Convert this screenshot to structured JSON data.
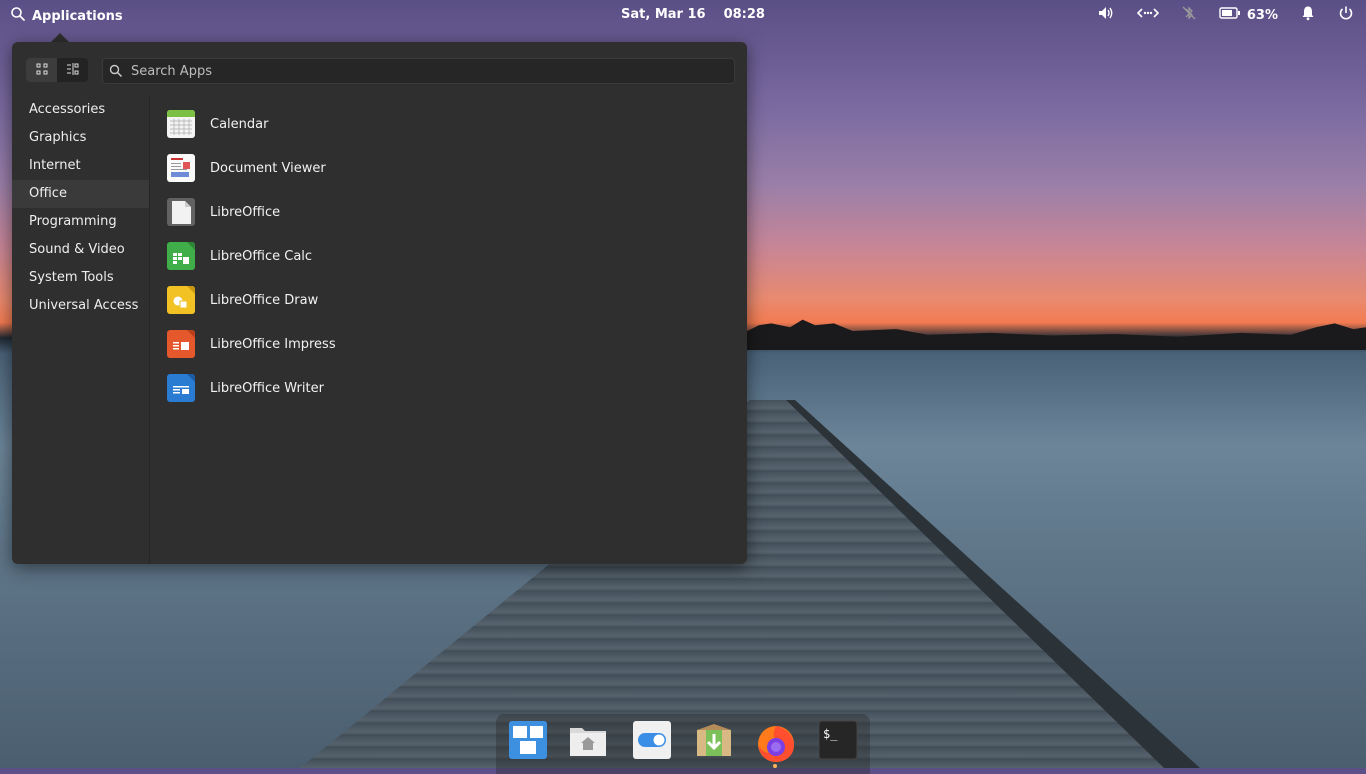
{
  "panel": {
    "applications_label": "Applications",
    "date": "Sat, Mar 16",
    "time": "08:28",
    "battery_percent": "63%"
  },
  "menu": {
    "search_placeholder": "Search Apps",
    "categories": [
      {
        "label": "Accessories"
      },
      {
        "label": "Graphics"
      },
      {
        "label": "Internet"
      },
      {
        "label": "Office",
        "selected": true
      },
      {
        "label": "Programming"
      },
      {
        "label": "Sound & Video"
      },
      {
        "label": "System Tools"
      },
      {
        "label": "Universal Access"
      }
    ],
    "apps": [
      {
        "label": "Calendar",
        "icon": "calendar-icon"
      },
      {
        "label": "Document Viewer",
        "icon": "document-viewer-icon"
      },
      {
        "label": "LibreOffice",
        "icon": "libreoffice-icon"
      },
      {
        "label": "LibreOffice Calc",
        "icon": "libreoffice-calc-icon"
      },
      {
        "label": "LibreOffice Draw",
        "icon": "libreoffice-draw-icon"
      },
      {
        "label": "LibreOffice Impress",
        "icon": "libreoffice-impress-icon"
      },
      {
        "label": "LibreOffice Writer",
        "icon": "libreoffice-writer-icon"
      }
    ]
  },
  "dock": {
    "items": [
      "multitasking-view-icon",
      "files-icon",
      "system-settings-icon",
      "appcenter-icon",
      "firefox-icon",
      "terminal-icon"
    ],
    "terminal_glyph": "$_"
  }
}
